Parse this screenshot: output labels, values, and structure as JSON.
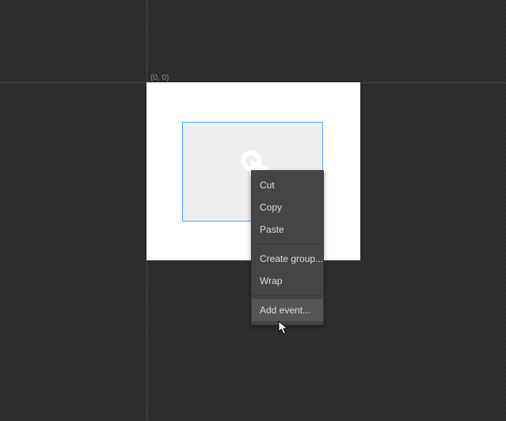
{
  "origin_label": "(0, 0)",
  "menu": {
    "cut": "Cut",
    "copy": "Copy",
    "paste": "Paste",
    "create_group": "Create group...",
    "wrap": "Wrap",
    "add_event": "Add event..."
  }
}
